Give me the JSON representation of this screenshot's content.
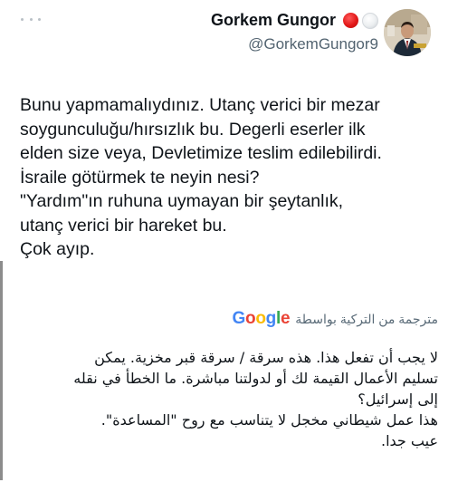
{
  "author": {
    "display_name": "Gorkem Gungor",
    "handle": "@GorkemGungor9",
    "badges": [
      "red-circle",
      "white-circle"
    ],
    "avatar_icon": "profile-photo"
  },
  "tweet": {
    "text": "Bunu yapmamalıydınız. Utanç verici bir mezar\nsoygunculuğu/hırsızlık bu. Degerli eserler ilk\nelden size veya, Devletimize teslim edilebilirdi.\nİsraile götürmek te neyin nesi?\n\"Yardım\"ın ruhuna uymayan bir şeytanlık,\nutanç verici bir hareket bu.\nÇok ayıp."
  },
  "translation": {
    "provider": "Google",
    "label": "مترجمة من التركية بواسطة",
    "text": "لا يجب أن تفعل هذا. هذه سرقة / سرقة قبر مخزية. يمكن\nتسليم الأعمال القيمة لك أو لدولتنا مباشرة. ما الخطأ في نقله\nإلى إسرائيل؟\nهذا عمل شيطاني مخجل لا يتناسب مع روح \"المساعدة\".\nعيب جدا."
  },
  "colors": {
    "text_primary": "#0f1419",
    "text_secondary": "#536471",
    "google_blue": "#4285f4",
    "google_red": "#ea4335",
    "google_yellow": "#fbbc05",
    "google_green": "#34a853"
  },
  "icons": {
    "more": "more-options-icon",
    "thread": "thread-line"
  }
}
